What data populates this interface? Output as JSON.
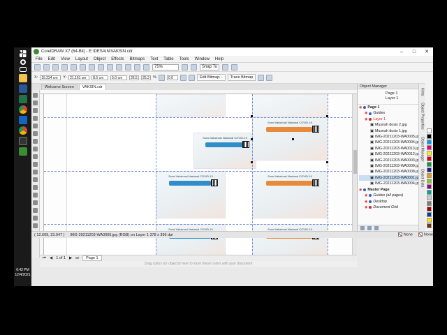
{
  "taskbar": {
    "icons": [
      "windows-start-icon",
      "search-icon",
      "task-view-icon",
      "file-explorer-icon",
      "word-icon",
      "excel-icon",
      "chrome-icon",
      "bluetooth-icon",
      "chrome-icon",
      "terminal-icon",
      "coreldraw-icon"
    ],
    "time": "6:42 PM",
    "date": "12/4/2021"
  },
  "window": {
    "title": "CorelDRAW X7 (64-Bit) - E:\\DESAIN\\VAKSIN.cdr"
  },
  "menu": [
    "File",
    "Edit",
    "View",
    "Layout",
    "Object",
    "Effects",
    "Bitmaps",
    "Text",
    "Table",
    "Tools",
    "Window",
    "Help"
  ],
  "toolbar": {
    "zoom": "75%",
    "snap": "Snap To"
  },
  "propbar": {
    "x": "15.234 cm",
    "y": "21.161 cm",
    "w": "8.6 cm",
    "h": "5.0 cm",
    "sx": "26.5",
    "sy": "25.3",
    "pct": "%",
    "angle": "0.0",
    "edit_bitmap": "Edit Bitmap...",
    "trace_bitmap": "Trace Bitmap"
  },
  "tabs": [
    "Welcome Screen",
    "VAKSIN.cdr"
  ],
  "pagenav": {
    "counter": "1 of 1",
    "page_tab": "Page 1"
  },
  "palette_hint": "Drag colors (or objects) here to store these colors with your document",
  "status": {
    "coords": "( 12.609, 23.047 )",
    "info": "IMG-20211203-WA0005.jpg (RGB) on Layer 1 378 x 396 dpi",
    "fill": "None",
    "outline": "None"
  },
  "object_manager": {
    "title": "Object Manager",
    "current_page": "Page 1",
    "current_layer": "Layer 1",
    "tree": [
      {
        "label": "Page 1",
        "level": 0,
        "kind": "page",
        "color": "#2f5fbf"
      },
      {
        "label": "Guides",
        "level": 1,
        "kind": "layer",
        "color": "#2f5fbf"
      },
      {
        "label": "Layer 1",
        "level": 1,
        "kind": "layer-active",
        "color": "#d22"
      },
      {
        "label": "Musnah dosis 2.jpg",
        "level": 2,
        "kind": "object"
      },
      {
        "label": "Musnah dosis 1.jpg",
        "level": 2,
        "kind": "object"
      },
      {
        "label": "IMG-20211203-WA0005.jpg",
        "level": 2,
        "kind": "object"
      },
      {
        "label": "IMG-20211203-WA0004.jpg",
        "level": 2,
        "kind": "object"
      },
      {
        "label": "IMG-20211203-WA0013.jpg",
        "level": 2,
        "kind": "object"
      },
      {
        "label": "IMG-20211203-WA0012.jpg",
        "level": 2,
        "kind": "object"
      },
      {
        "label": "IMG-20211203-WA0003.jpg",
        "level": 2,
        "kind": "object"
      },
      {
        "label": "IMG-20211203-WA0009.jpg",
        "level": 2,
        "kind": "object"
      },
      {
        "label": "IMG-20211203-WA0008.jpg",
        "level": 2,
        "kind": "object"
      },
      {
        "label": "IMG-20211203-WA0001.jpg",
        "level": 2,
        "kind": "object-selected"
      },
      {
        "label": "IMG-20211203-WA0004.jpg",
        "level": 2,
        "kind": "object"
      },
      {
        "label": "Master Page",
        "level": 0,
        "kind": "page",
        "color": "#2f5fbf"
      },
      {
        "label": "Guides (all pages)",
        "level": 1,
        "kind": "layer",
        "color": "#2f5fbf"
      },
      {
        "label": "Desktop",
        "level": 1,
        "kind": "layer",
        "color": "#2f5fbf"
      },
      {
        "label": "Document Grid",
        "level": 1,
        "kind": "layer",
        "color": "#d22"
      }
    ]
  },
  "side_tabs": [
    "Hints",
    "Object Properties",
    "Object Manager",
    "Object Data"
  ],
  "palette_colors": [
    "#ffffff",
    "#000000",
    "#00a0e9",
    "#e4007f",
    "#fff100",
    "#e60012",
    "#009944",
    "#1d2088",
    "#f39800",
    "#8fc31f",
    "#920783",
    "#00a29a",
    "#c9caca",
    "#7d7d7d",
    "#a40000",
    "#004098",
    "#ffe100",
    "#6a3906"
  ],
  "card_titles": [
    "Surat Vaksinasi Nasional COVID-19"
  ]
}
